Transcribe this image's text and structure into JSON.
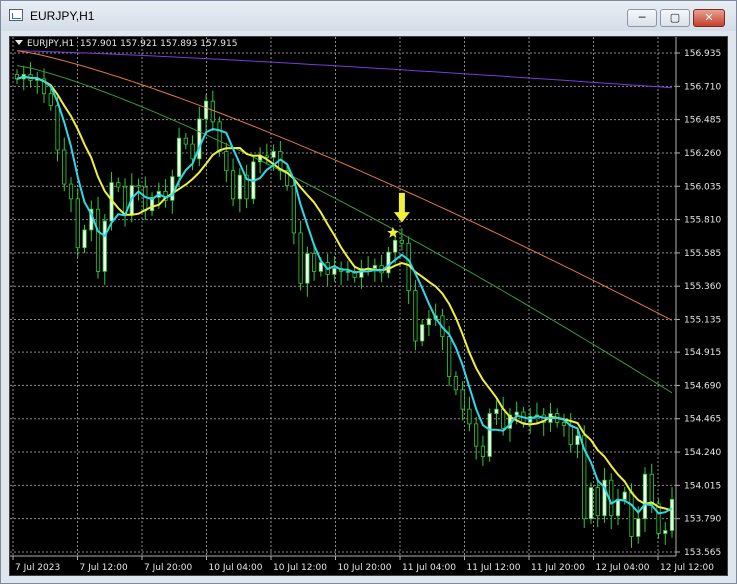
{
  "window": {
    "title": "EURJPY,H1",
    "controls": {
      "minimize": "─",
      "maximize": "▢",
      "close": "✕"
    }
  },
  "chart_header": {
    "symbol": "EURJPY,H1",
    "ohlc": "157.901 157.921 157.893 157.915"
  },
  "colors": {
    "background": "#000000",
    "grid": "#8a8a8a",
    "candle_bull": "#f0fff0",
    "candle_outline": "#32cd32",
    "ma_fast": "#2fd8e8",
    "ma_mid": "#f2ef3a",
    "ma_slow1": "#3a9a3a",
    "ma_slow2": "#e07a3a",
    "ma_slow3": "#7b3ad9",
    "signal": "#f2ef3a",
    "axis_text": "#e6e6e6"
  },
  "chart_data": {
    "type": "candlestick",
    "x_tick_labels": [
      "7 Jul 2023",
      "7 Jul 12:00",
      "7 Jul 20:00",
      "10 Jul 04:00",
      "10 Jul 12:00",
      "10 Jul 20:00",
      "11 Jul 04:00",
      "11 Jul 12:00",
      "11 Jul 20:00",
      "12 Jul 04:00",
      "12 Jul 12:00"
    ],
    "y_tick_labels": [
      "156.935",
      "156.710",
      "156.485",
      "156.260",
      "156.035",
      "155.810",
      "155.585",
      "155.360",
      "155.135",
      "154.915",
      "154.690",
      "154.465",
      "154.240",
      "154.015",
      "153.790",
      "153.565"
    ],
    "ylim": [
      153.565,
      156.935
    ],
    "closes": [
      156.76,
      156.79,
      156.75,
      156.76,
      156.66,
      156.58,
      156.28,
      156.05,
      155.95,
      155.62,
      155.74,
      155.88,
      155.46,
      155.8,
      156.06,
      156.03,
      155.84,
      156.04,
      156.03,
      155.87,
      155.96,
      156.0,
      155.94,
      156.1,
      156.36,
      156.32,
      156.22,
      156.49,
      156.61,
      156.47,
      156.27,
      156.14,
      155.95,
      156.11,
      155.95,
      156.2,
      156.24,
      156.23,
      156.27,
      156.14,
      156.04,
      155.72,
      155.38,
      155.58,
      155.46,
      155.52,
      155.44,
      155.48,
      155.46,
      155.46,
      155.42,
      155.48,
      155.48,
      155.5,
      155.45,
      155.59,
      155.67,
      155.65,
      155.33,
      154.99,
      155.1,
      155.14,
      155.16,
      155.02,
      154.75,
      154.66,
      154.53,
      154.43,
      154.28,
      154.21,
      154.5,
      154.53,
      154.4,
      154.49,
      154.51,
      154.44,
      154.48,
      154.49,
      154.44,
      154.5,
      154.44,
      154.42,
      154.29,
      154.35,
      153.79,
      154.0,
      153.81,
      154.05,
      153.81,
      153.92,
      153.97,
      153.67,
      153.79,
      154.09,
      153.89,
      153.69,
      153.71,
      153.92
    ]
  }
}
